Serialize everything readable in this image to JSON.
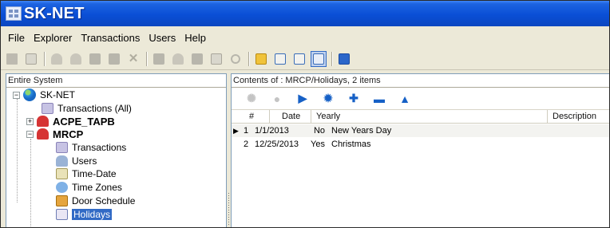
{
  "window": {
    "title": "SK-NET"
  },
  "menu": [
    "File",
    "Explorer",
    "Transactions",
    "Users",
    "Help"
  ],
  "toolbar": {
    "icons": [
      "print-icon",
      "document-icon",
      "users-icon",
      "users-alt-icon",
      "card-icon",
      "card-alt-icon",
      "delete-icon",
      "book-icon",
      "badge-icon",
      "lock-icon",
      "monitor-icon",
      "refresh-icon",
      "upload-icon",
      "calendar-day-icon",
      "calendar-week-icon",
      "calendar-month-icon",
      "calendar-app-icon"
    ]
  },
  "left_panel": {
    "header": "Entire System",
    "tree": [
      {
        "label": "SK-NET",
        "icon": "globe-icon",
        "expanded": true
      },
      {
        "label": "Transactions (All)",
        "icon": "transactions-icon"
      },
      {
        "label": "ACPE_TAPB",
        "icon": "site-icon",
        "expanded": false
      },
      {
        "label": "MRCP",
        "icon": "site-icon",
        "expanded": true
      },
      {
        "label": "Transactions",
        "icon": "transactions-icon"
      },
      {
        "label": "Users",
        "icon": "users-icon"
      },
      {
        "label": "Time-Date",
        "icon": "time-date-icon"
      },
      {
        "label": "Time Zones",
        "icon": "time-zones-icon"
      },
      {
        "label": "Door Schedule",
        "icon": "door-schedule-icon"
      },
      {
        "label": "Holidays",
        "icon": "holidays-icon",
        "selected": true
      }
    ]
  },
  "right_panel": {
    "header": "Contents of : MRCP/Holidays, 2  items",
    "grid_toolbar": [
      "first-icon",
      "prev-icon",
      "next-icon",
      "last-icon",
      "add-icon",
      "remove-icon",
      "move-up-icon"
    ],
    "columns": [
      "#",
      "Date",
      "Yearly",
      "Description"
    ],
    "rows": [
      {
        "num": "1",
        "date": "1/1/2013",
        "yearly": "No",
        "description": "New Years Day"
      },
      {
        "num": "2",
        "date": "12/25/2013",
        "yearly": "Yes",
        "description": "Christmas"
      }
    ]
  }
}
